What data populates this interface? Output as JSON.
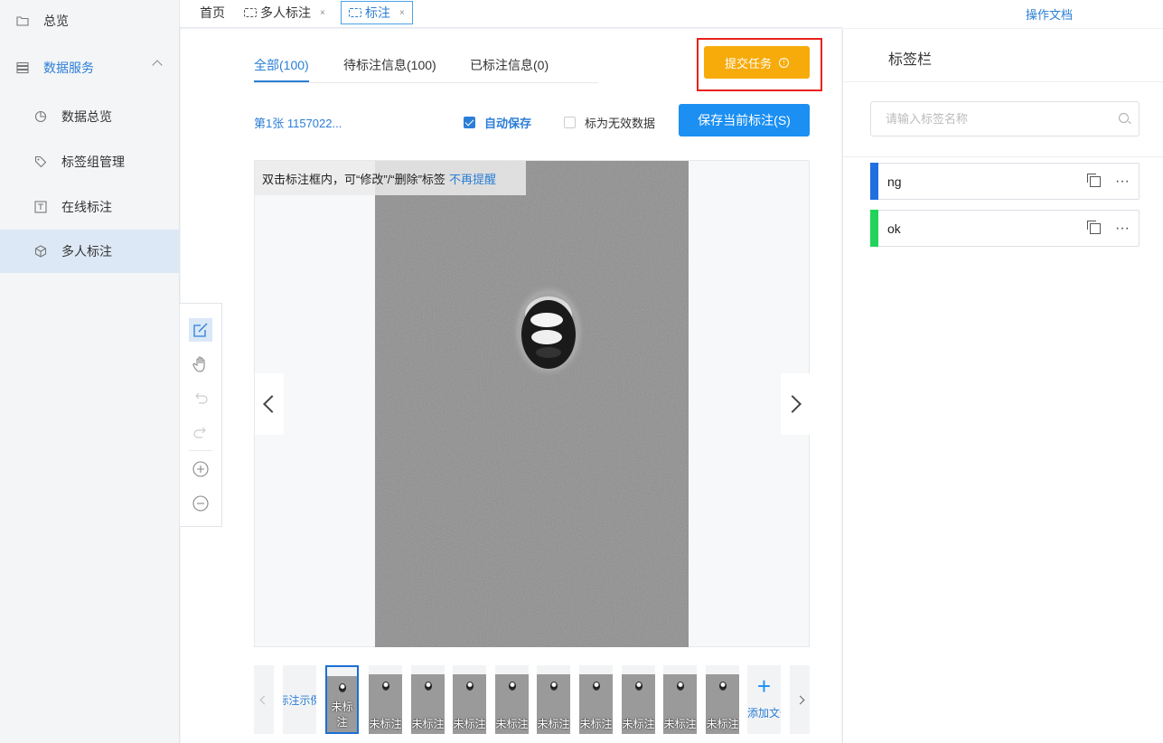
{
  "sidebar": {
    "items": [
      {
        "label": "总览",
        "icon": "folder-icon"
      },
      {
        "label": "数据服务",
        "icon": "database-icon"
      },
      {
        "label": "数据总览",
        "icon": "pie-chart-icon"
      },
      {
        "label": "标签组管理",
        "icon": "tag-icon"
      },
      {
        "label": "在线标注",
        "icon": "text-box-icon"
      },
      {
        "label": "多人标注",
        "icon": "cube-icon"
      }
    ]
  },
  "tabs": {
    "home": "首页",
    "multi": "多人标注",
    "annotate": "标注",
    "close": "×"
  },
  "doc_link": "操作文档",
  "filter_tabs": [
    {
      "label": "全部(100)"
    },
    {
      "label": "待标注信息(100)"
    },
    {
      "label": "已标注信息(0)"
    }
  ],
  "submit_label": "提交任务",
  "submit_info": "!",
  "filename": "第1张 1157022...",
  "auto_save": "自动保存",
  "mark_invalid": "标为无效数据",
  "save_current": "保存当前标注(S)",
  "hint": {
    "text": "双击标注框内，可“修改”/“删除”标签",
    "dismiss": "不再提醒"
  },
  "thumbnails": {
    "example": "标注示例",
    "unlabeled": "未标注",
    "add_file": "添加文件",
    "add_plus": "+"
  },
  "right_panel": {
    "title": "标签栏",
    "search_placeholder": "请输入标签名称",
    "labels": [
      {
        "name": "ng",
        "color": "#1f6fe0"
      },
      {
        "name": "ok",
        "color": "#22d35a"
      }
    ],
    "more": "···"
  },
  "colors": {
    "accent": "#2b7ed6",
    "submit": "#f7ab0a",
    "highlight_box": "#e8221c"
  }
}
